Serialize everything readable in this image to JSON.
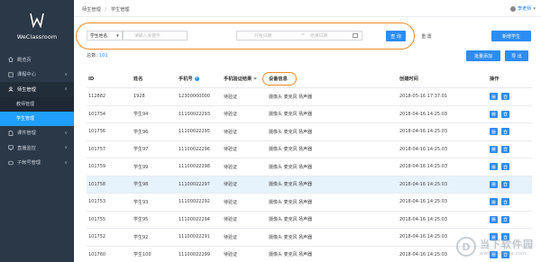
{
  "app": {
    "name": "WeClassroom"
  },
  "sidebar": {
    "items": [
      {
        "label": "概览页",
        "icon": "home-icon",
        "arrow": ""
      },
      {
        "label": "课程中心",
        "icon": "book-icon",
        "arrow": "∨"
      },
      {
        "label": "师生管理",
        "icon": "users-icon",
        "arrow": "∧"
      },
      {
        "label": "教师管理",
        "sub": true
      },
      {
        "label": "学生管理",
        "sub": true,
        "active": true
      },
      {
        "label": "课件管理",
        "icon": "file-icon",
        "arrow": "∨"
      },
      {
        "label": "直播监控",
        "icon": "monitor-icon",
        "arrow": "∨"
      },
      {
        "label": "子帐号管理",
        "icon": "account-icon",
        "arrow": "∨"
      }
    ]
  },
  "breadcrumb": {
    "parent": "师生管理",
    "separator": "/",
    "current": "学生管理"
  },
  "user": {
    "name": "李老师"
  },
  "filter": {
    "field_select": "学生姓名",
    "search_placeholder": "请输入关键字",
    "date_start_placeholder": "开始日期",
    "date_separator": "~",
    "date_end_placeholder": "结束日期",
    "query_label": "查 询",
    "reset_label": "重 置"
  },
  "actions": {
    "add_label": "新增学生",
    "batch_label": "批量添加",
    "export_label": "导 出"
  },
  "total": {
    "label": "总数:",
    "value": "101"
  },
  "table": {
    "headers": [
      "ID",
      "姓名",
      "手机号",
      "手机验证结果",
      "设备信息",
      "创建时间",
      "操作"
    ],
    "rows": [
      {
        "id": "112882",
        "name": "1928",
        "phone": "12300000000",
        "verify": "待验证",
        "device": "摄像头  麦克风  扬声器",
        "created": "2018-05-16 17:37:01"
      },
      {
        "id": "101754",
        "name": "学生94",
        "phone": "11100022293",
        "verify": "待验证",
        "device": "摄像头  麦克风  扬声器",
        "created": "2018-04-16 14:25:03"
      },
      {
        "id": "101756",
        "name": "学生96",
        "phone": "11100022295",
        "verify": "待验证",
        "device": "摄像头  麦克风  扬声器",
        "created": "2018-04-16 14:25:03"
      },
      {
        "id": "101757",
        "name": "学生97",
        "phone": "11100022296",
        "verify": "待验证",
        "device": "摄像头  麦克风  扬声器",
        "created": "2018-04-16 14:25:03"
      },
      {
        "id": "101759",
        "name": "学生99",
        "phone": "11100022298",
        "verify": "待验证",
        "device": "摄像头  麦克风  扬声器",
        "created": "2018-04-16 14:25:03"
      },
      {
        "id": "101758",
        "name": "学生98",
        "phone": "11100022297",
        "verify": "待验证",
        "device": "摄像头  麦克风  扬声器",
        "created": "2018-04-16 14:25:03",
        "highlight": true
      },
      {
        "id": "101753",
        "name": "学生93",
        "phone": "11100022292",
        "verify": "待验证",
        "device": "摄像头  麦克风  扬声器",
        "created": "2018-04-16 14:25:03"
      },
      {
        "id": "101755",
        "name": "学生95",
        "phone": "11100022294",
        "verify": "待验证",
        "device": "摄像头  麦克风  扬声器",
        "created": "2018-04-16 14:25:03"
      },
      {
        "id": "101752",
        "name": "学生92",
        "phone": "11100022291",
        "verify": "待验证",
        "device": "摄像头  麦克风  扬声器",
        "created": "2018-04-16 14:25:03"
      },
      {
        "id": "101760",
        "name": "学生100",
        "phone": "11100022299",
        "verify": "待验证",
        "device": "摄像头  麦克风  扬声器",
        "created": "2018-04-16 14:25:03"
      }
    ]
  },
  "watermark": {
    "brand": "当下软件园",
    "url": "www.downxia.com"
  },
  "colors": {
    "sidebar": "#2b3847",
    "accent": "#2d8cf0",
    "annotation": "#f08a2a",
    "highlight_row": "#e6f3fd"
  }
}
